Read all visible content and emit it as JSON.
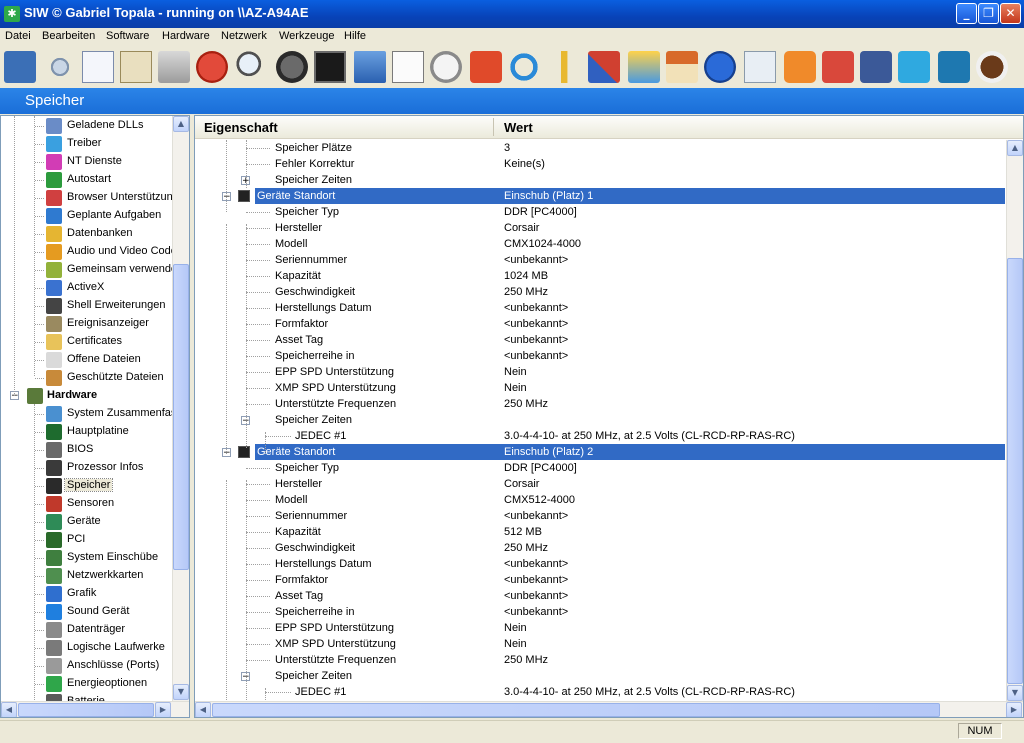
{
  "window": {
    "title": "SIW  © Gabriel Topala - running on \\\\AZ-A94AE"
  },
  "menu": [
    "Datei",
    "Bearbeiten",
    "Software",
    "Hardware",
    "Netzwerk",
    "Werkzeuge",
    "Hilfe"
  ],
  "toolbar": {
    "icons": [
      "save-icon",
      "cut-icon",
      "copy-icon",
      "paste-icon",
      "print-icon",
      "stop-icon",
      "search-icon",
      "gauge-icon",
      "monitor-icon",
      "network-icon",
      "list-icon",
      "stopwatch-icon",
      "shutdown-icon",
      "refresh-icon",
      "key-icon",
      "tools-icon",
      "magic-icon",
      "home-icon",
      "help-icon",
      "mail-icon",
      "rss-icon",
      "google-plus-icon",
      "facebook-icon",
      "twitter-icon",
      "linkedin-icon",
      "coffee-icon"
    ]
  },
  "band": {
    "title": "Speicher"
  },
  "tree": {
    "items": [
      {
        "label": "Geladene DLLs",
        "icon": "dll-icon",
        "color": "#6a8cc7"
      },
      {
        "label": "Treiber",
        "icon": "driver-icon",
        "color": "#3aa0e0"
      },
      {
        "label": "NT Dienste",
        "icon": "services-icon",
        "color": "#d23cb5"
      },
      {
        "label": "Autostart",
        "icon": "autostart-icon",
        "color": "#2c9b3d"
      },
      {
        "label": "Browser Unterstützun",
        "icon": "browser-icon",
        "color": "#d04040"
      },
      {
        "label": "Geplante Aufgaben",
        "icon": "tasks-icon",
        "color": "#2f7ad0"
      },
      {
        "label": "Datenbanken",
        "icon": "database-icon",
        "color": "#e5b532"
      },
      {
        "label": "Audio und Video Code",
        "icon": "codec-icon",
        "color": "#e59b20"
      },
      {
        "label": "Gemeinsam verwende",
        "icon": "shared-icon",
        "color": "#93b23a"
      },
      {
        "label": "ActiveX",
        "icon": "activex-icon",
        "color": "#3a72d0"
      },
      {
        "label": "Shell Erweiterungen",
        "icon": "shell-icon",
        "color": "#444444"
      },
      {
        "label": "Ereignisanzeiger",
        "icon": "eventlog-icon",
        "color": "#9a8a60"
      },
      {
        "label": "Certificates",
        "icon": "certificate-icon",
        "color": "#e8c35a"
      },
      {
        "label": "Offene Dateien",
        "icon": "open-files-icon",
        "color": "#dadada"
      },
      {
        "label": "Geschützte Dateien",
        "icon": "protected-files-icon",
        "color": "#c88a3a"
      },
      {
        "label": "Hardware",
        "icon": "hardware-icon",
        "color": "#5a7a3a",
        "category": true
      },
      {
        "label": "System Zusammenfas",
        "icon": "system-summary-icon",
        "color": "#4a90d0"
      },
      {
        "label": "Hauptplatine",
        "icon": "motherboard-icon",
        "color": "#1e6b2e"
      },
      {
        "label": "BIOS",
        "icon": "bios-icon",
        "color": "#6a6a6a"
      },
      {
        "label": "Prozessor Infos",
        "icon": "cpu-icon",
        "color": "#3a3a3a"
      },
      {
        "label": "Speicher",
        "icon": "memory-icon",
        "color": "#2a2a2a",
        "selected": true
      },
      {
        "label": "Sensoren",
        "icon": "sensor-icon",
        "color": "#c0392b"
      },
      {
        "label": "Geräte",
        "icon": "devices-icon",
        "color": "#2e8b57"
      },
      {
        "label": "PCI",
        "icon": "pci-icon",
        "color": "#2a6a2a"
      },
      {
        "label": "System Einschübe",
        "icon": "slots-icon",
        "color": "#3f7f3f"
      },
      {
        "label": "Netzwerkkarten",
        "icon": "nic-icon",
        "color": "#4f8f4f"
      },
      {
        "label": "Grafik",
        "icon": "graphics-icon",
        "color": "#2f6fcf"
      },
      {
        "label": "Sound Gerät",
        "icon": "sound-icon",
        "color": "#1f7fdf"
      },
      {
        "label": "Datenträger",
        "icon": "disk-icon",
        "color": "#8a8a8a"
      },
      {
        "label": "Logische Laufwerke",
        "icon": "drive-icon",
        "color": "#7a7a7a"
      },
      {
        "label": "Anschlüsse (Ports)",
        "icon": "ports-icon",
        "color": "#9a9a9a"
      },
      {
        "label": "Energieoptionen",
        "icon": "power-icon",
        "color": "#2fa64a"
      },
      {
        "label": "Batterie",
        "icon": "battery-icon",
        "color": "#5a5a5a"
      }
    ]
  },
  "columns": {
    "property": "Eigenschaft",
    "value": "Wert"
  },
  "rows": [
    {
      "prop": "Speicher Plätze",
      "val": "3",
      "level": 2
    },
    {
      "prop": "Fehler Korrektur",
      "val": "Keine(s)",
      "level": 2
    },
    {
      "prop": "Speicher Zeiten",
      "val": "",
      "level": 2,
      "expander": "+"
    },
    {
      "prop": "Geräte Standort",
      "val": "Einschub (Platz) 1",
      "level": 1,
      "highlight": true,
      "expander": "−"
    },
    {
      "prop": "Speicher Typ",
      "val": "DDR [PC4000]",
      "level": 2
    },
    {
      "prop": "Hersteller",
      "val": "Corsair",
      "level": 2
    },
    {
      "prop": "Modell",
      "val": "CMX1024-4000",
      "level": 2
    },
    {
      "prop": "Seriennummer",
      "val": "<unbekannt>",
      "level": 2
    },
    {
      "prop": "Kapazität",
      "val": "1024 MB",
      "level": 2
    },
    {
      "prop": "Geschwindigkeit",
      "val": "250 MHz",
      "level": 2
    },
    {
      "prop": "Herstellungs Datum",
      "val": "<unbekannt>",
      "level": 2
    },
    {
      "prop": "Formfaktor",
      "val": "<unbekannt>",
      "level": 2
    },
    {
      "prop": "Asset Tag",
      "val": "<unbekannt>",
      "level": 2
    },
    {
      "prop": "Speicherreihe in",
      "val": "<unbekannt>",
      "level": 2
    },
    {
      "prop": "EPP SPD Unterstützung",
      "val": "Nein",
      "level": 2
    },
    {
      "prop": "XMP SPD Unterstützung",
      "val": "Nein",
      "level": 2
    },
    {
      "prop": "Unterstützte Frequenzen",
      "val": "250 MHz",
      "level": 2
    },
    {
      "prop": "Speicher Zeiten",
      "val": "",
      "level": 2,
      "expander": "−"
    },
    {
      "prop": "JEDEC #1",
      "val": "3.0-4-4-10- at 250 MHz, at 2.5 Volts (CL-RCD-RP-RAS-RC)",
      "level": 3
    },
    {
      "prop": "Geräte Standort",
      "val": "Einschub (Platz) 2",
      "level": 1,
      "highlight": true,
      "expander": "−"
    },
    {
      "prop": "Speicher Typ",
      "val": "DDR [PC4000]",
      "level": 2
    },
    {
      "prop": "Hersteller",
      "val": "Corsair",
      "level": 2
    },
    {
      "prop": "Modell",
      "val": "CMX512-4000",
      "level": 2
    },
    {
      "prop": "Seriennummer",
      "val": "<unbekannt>",
      "level": 2
    },
    {
      "prop": "Kapazität",
      "val": "512 MB",
      "level": 2
    },
    {
      "prop": "Geschwindigkeit",
      "val": "250 MHz",
      "level": 2
    },
    {
      "prop": "Herstellungs Datum",
      "val": "<unbekannt>",
      "level": 2
    },
    {
      "prop": "Formfaktor",
      "val": "<unbekannt>",
      "level": 2
    },
    {
      "prop": "Asset Tag",
      "val": "<unbekannt>",
      "level": 2
    },
    {
      "prop": "Speicherreihe in",
      "val": "<unbekannt>",
      "level": 2
    },
    {
      "prop": "EPP SPD Unterstützung",
      "val": "Nein",
      "level": 2
    },
    {
      "prop": "XMP SPD Unterstützung",
      "val": "Nein",
      "level": 2
    },
    {
      "prop": "Unterstützte Frequenzen",
      "val": "250 MHz",
      "level": 2
    },
    {
      "prop": "Speicher Zeiten",
      "val": "",
      "level": 2,
      "expander": "−"
    },
    {
      "prop": "JEDEC #1",
      "val": "3.0-4-4-10- at 250 MHz, at 2.5 Volts (CL-RCD-RP-RAS-RC)",
      "level": 3
    }
  ],
  "status": {
    "num": "NUM"
  }
}
